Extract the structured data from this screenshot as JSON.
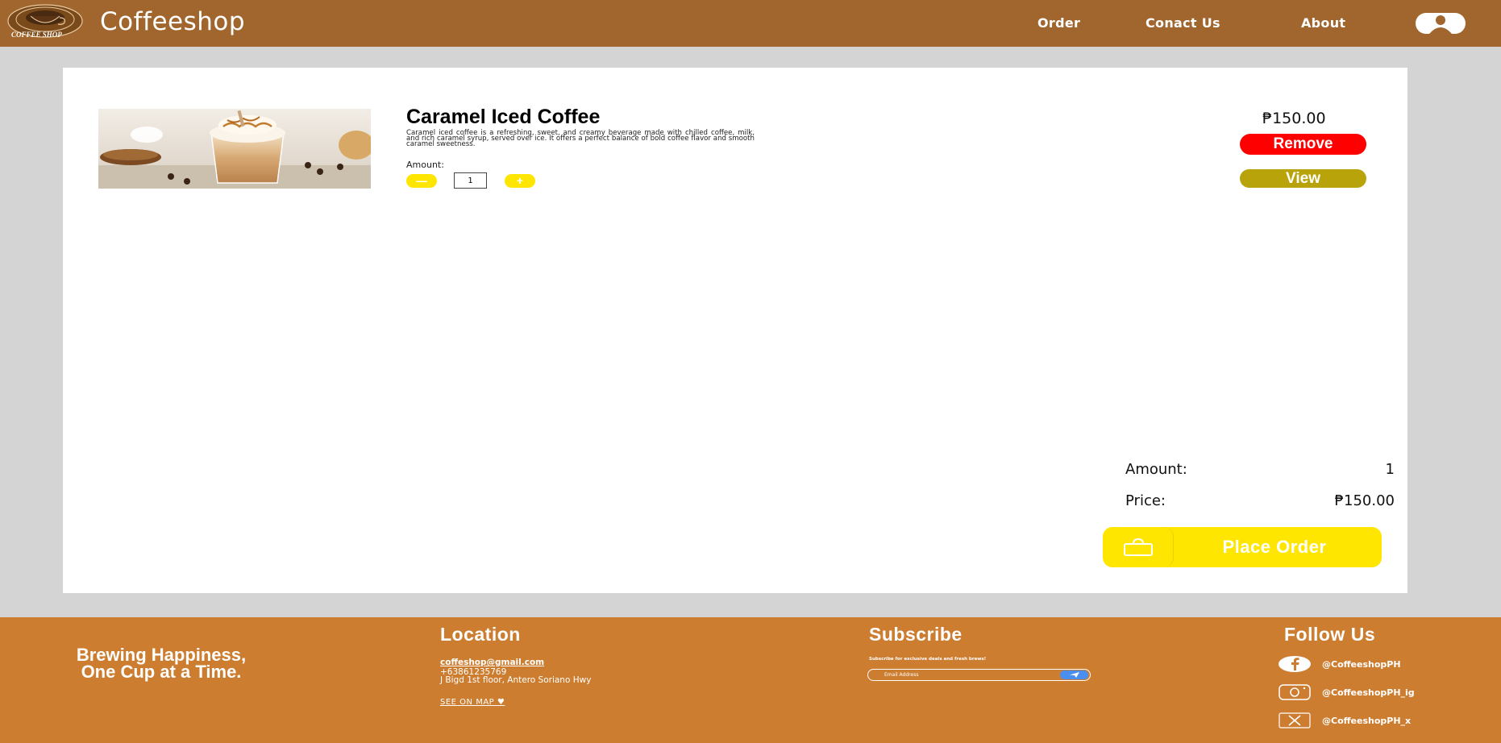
{
  "header": {
    "brand": "Coffeeshop",
    "logo_text": "COFFEE SHOP",
    "nav": {
      "order": "Order",
      "contact": "Conact Us",
      "about": "About"
    }
  },
  "product": {
    "name": "Caramel Iced Coffee",
    "description": "Caramel iced coffee is a refreshing, sweet, and creamy beverage made with chilled coffee, milk, and rich caramel syrup, served over ice. It offers a perfect balance of bold coffee flavor and smooth caramel sweetness.",
    "amount_label": "Amount:",
    "quantity": "1",
    "minus_label": "—",
    "plus_label": "+",
    "price": "₱150.00",
    "remove_label": "Remove",
    "view_label": "View"
  },
  "summary": {
    "amount_label": "Amount:",
    "amount_value": "1",
    "price_label": "Price:",
    "price_value": "₱150.00",
    "place_order_label": "Place Order"
  },
  "footer": {
    "tagline": "Brewing Happiness, One Cup at a Time.",
    "location": {
      "heading": "Location",
      "email": "coffeshop@gmail.com",
      "phone": "+63861235769",
      "address": "J Bigd 1st floor, Antero Soriano Hwy",
      "map_link": "SEE ON MAP ♥"
    },
    "subscribe": {
      "heading": "Subscribe",
      "text": "Subscribe for exclusive deals and fresh brews!",
      "placeholder": "Email Address"
    },
    "follow": {
      "heading": "Follow Us",
      "facebook": "@CoffeeshopPH",
      "instagram": "@CoffeeshopPH_ig",
      "x": "@CoffeeshopPH_x"
    }
  },
  "colors": {
    "header_bg": "#a0662e",
    "footer_bg": "#cd7d30",
    "accent_yellow": "#ffe600",
    "remove_red": "#ff0000",
    "view_olive": "#b8a30a"
  }
}
